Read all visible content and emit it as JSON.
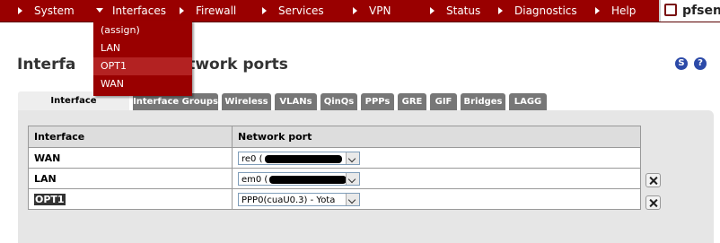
{
  "nav": {
    "items": [
      {
        "label": "System"
      },
      {
        "label": "Interfaces"
      },
      {
        "label": "Firewall"
      },
      {
        "label": "Services"
      },
      {
        "label": "VPN"
      },
      {
        "label": "Status"
      },
      {
        "label": "Diagnostics"
      },
      {
        "label": "Help"
      }
    ],
    "brand": "pfsense",
    "brand_color": "#990000"
  },
  "interfaces_menu": {
    "items": [
      {
        "label": "(assign)"
      },
      {
        "label": "LAN"
      },
      {
        "label": "OPT1"
      },
      {
        "label": "WAN"
      }
    ],
    "highlighted": "OPT1"
  },
  "page": {
    "title": "Interfaces: Assign network ports",
    "visible_title_left": "Interfa",
    "visible_title_right": "ssign network ports",
    "help_icons": [
      "S",
      "?"
    ]
  },
  "tabs": [
    {
      "label": "Interface assignments",
      "active": true
    },
    {
      "label": "Interface Groups"
    },
    {
      "label": "Wireless"
    },
    {
      "label": "VLANs"
    },
    {
      "label": "QinQs"
    },
    {
      "label": "PPPs"
    },
    {
      "label": "GRE"
    },
    {
      "label": "GIF"
    },
    {
      "label": "Bridges"
    },
    {
      "label": "LAGG"
    }
  ],
  "table": {
    "headers": [
      "Interface",
      "Network port"
    ],
    "rows": [
      {
        "interface": "WAN",
        "port": "re0 (",
        "redacted": true,
        "deletable": false
      },
      {
        "interface": "LAN",
        "port": "em0 (",
        "redacted": true,
        "deletable": true
      },
      {
        "interface": "OPT1",
        "port": "PPP0(cuaU0.3) - Yota",
        "redacted": false,
        "deletable": true
      }
    ]
  }
}
